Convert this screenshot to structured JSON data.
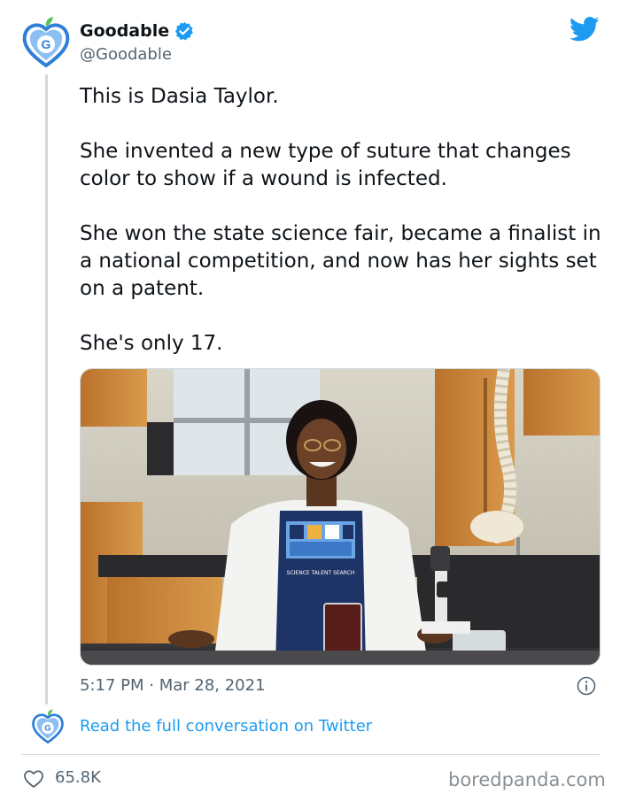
{
  "author": {
    "name": "Goodable",
    "handle": "@Goodable",
    "avatar_letter": "G"
  },
  "tweet": {
    "paragraphs": [
      "This is Dasia Taylor.",
      "She invented a new type of suture that changes color to show if a wound is infected.",
      "She won the state science fair, became a finalist in a national competition, and now has her sights set on a patent.",
      "She's only 17."
    ],
    "timestamp": "5:17 PM · Mar 28, 2021"
  },
  "footer": {
    "read_link": "Read the full conversation on Twitter",
    "likes": "65.8K",
    "watermark": "boredpanda.com"
  },
  "colors": {
    "twitter_blue": "#1d9bf0",
    "text": "#0f1419",
    "muted": "#536471",
    "brand_blue": "#2f7ed8"
  },
  "icons": [
    "goodable-logo-icon",
    "verified-badge-icon",
    "twitter-bird-icon",
    "info-icon",
    "heart-icon"
  ]
}
